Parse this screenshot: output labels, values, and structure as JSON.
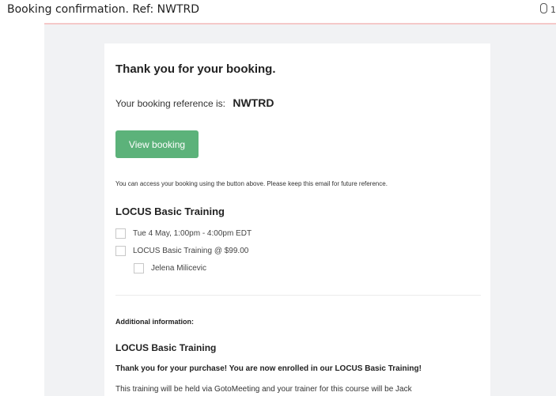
{
  "email": {
    "subject": "Booking confirmation. Ref: NWTRD",
    "attachment_count": "1"
  },
  "booking": {
    "heading": "Thank you for your booking.",
    "reference_label": "Your booking reference is:",
    "reference_code": "NWTRD",
    "view_button": "View booking",
    "access_note": "You can access your booking using the button above. Please keep this email for future reference.",
    "event_title": "LOCUS Basic Training",
    "items": [
      {
        "text": "Tue 4 May, 1:00pm - 4:00pm EDT"
      },
      {
        "text": "LOCUS Basic Training @ $99.00"
      },
      {
        "text": "Jelena Milicevic"
      }
    ]
  },
  "additional": {
    "label": "Additional information:",
    "title": "LOCUS Basic Training",
    "purchase_text": "Thank you for your purchase!  You are now enrolled in our LOCUS Basic Training!",
    "body_text": "This training will be held via GotoMeeting and your trainer for this course will be Jack"
  },
  "colors": {
    "button": "#5cb27a",
    "canvas": "#f1f2f4",
    "divider": "#f5c9c9"
  }
}
